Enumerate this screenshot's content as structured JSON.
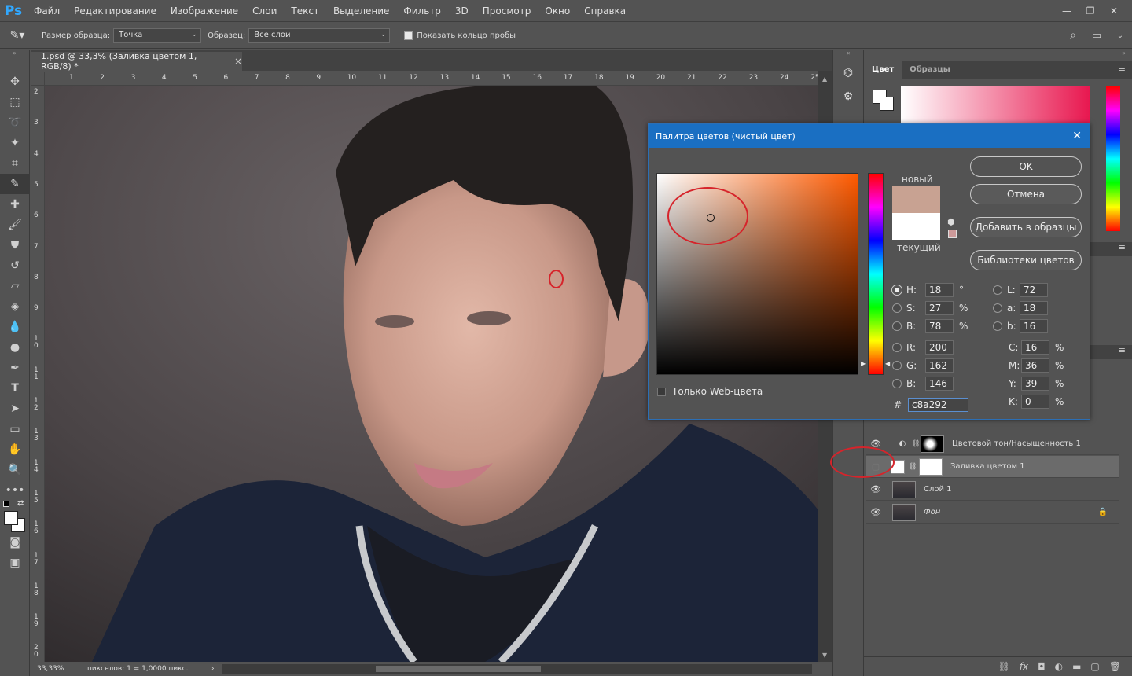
{
  "app": {
    "logo": "Ps"
  },
  "menu": [
    "Файл",
    "Редактирование",
    "Изображение",
    "Слои",
    "Текст",
    "Выделение",
    "Фильтр",
    "3D",
    "Просмотр",
    "Окно",
    "Справка"
  ],
  "window_controls": {
    "minimize": "—",
    "restore": "❐",
    "close": "✕"
  },
  "options": {
    "sample_size_label": "Размер образца:",
    "sample_size_value": "Точка",
    "sample_label": "Образец:",
    "sample_value": "Все слои",
    "show_ring_label": "Показать кольцо пробы",
    "show_ring_checked": true
  },
  "document": {
    "tab_title": "1.psd @ 33,3% (Заливка цветом 1, RGB/8) *",
    "close": "×",
    "zoom": "33,33%",
    "status": "пикселов: 1 = 1,0000 пикс."
  },
  "ruler_top": [
    "1",
    "2",
    "3",
    "4",
    "5",
    "6",
    "7",
    "8",
    "9",
    "10",
    "11",
    "12",
    "13",
    "14",
    "15",
    "16",
    "17",
    "18",
    "19",
    "20",
    "21",
    "22",
    "23",
    "24",
    "25"
  ],
  "ruler_left": [
    "2",
    "3",
    "4",
    "5",
    "6",
    "7",
    "8",
    "9",
    "1 0",
    "1 1",
    "1 2",
    "1 3",
    "1 4",
    "1 5",
    "1 6",
    "1 7",
    "1 8",
    "1 9",
    "2 0"
  ],
  "panels": {
    "tabs": [
      "Цвет",
      "Образцы"
    ]
  },
  "layers": [
    {
      "name": "Цветовой тон/Насыщенность 1",
      "visible": true,
      "selected": false,
      "italic": false
    },
    {
      "name": "Заливка цветом 1",
      "visible": false,
      "selected": true,
      "italic": false
    },
    {
      "name": "Слой 1",
      "visible": true,
      "selected": false,
      "italic": false
    },
    {
      "name": "Фон",
      "visible": true,
      "selected": false,
      "italic": true,
      "locked": true
    }
  ],
  "dialog": {
    "title": "Палитра цветов (чистый цвет)",
    "new_label": "новый",
    "current_label": "текущий",
    "new_color": "#c8a292",
    "current_color": "#ffffff",
    "buttons": {
      "ok": "OK",
      "cancel": "Отмена",
      "add_swatches": "Добавить в образцы",
      "libraries": "Библиотеки цветов"
    },
    "web_only_label": "Только Web-цвета",
    "hsb": {
      "H": "18",
      "S": "27",
      "B": "78",
      "H_unit": "°",
      "S_unit": "%",
      "B_unit": "%"
    },
    "lab": {
      "L": "72",
      "a": "18",
      "b": "16"
    },
    "rgb": {
      "R": "200",
      "G": "162",
      "B": "146"
    },
    "cmyk": {
      "C": "16",
      "M": "36",
      "Y": "39",
      "K": "0",
      "unit": "%"
    },
    "hex_label": "#",
    "hex": "c8a292"
  },
  "colors": {
    "accent": "#1a6fc2",
    "annotation": "#d6242b",
    "hue": "#ff5a00"
  }
}
